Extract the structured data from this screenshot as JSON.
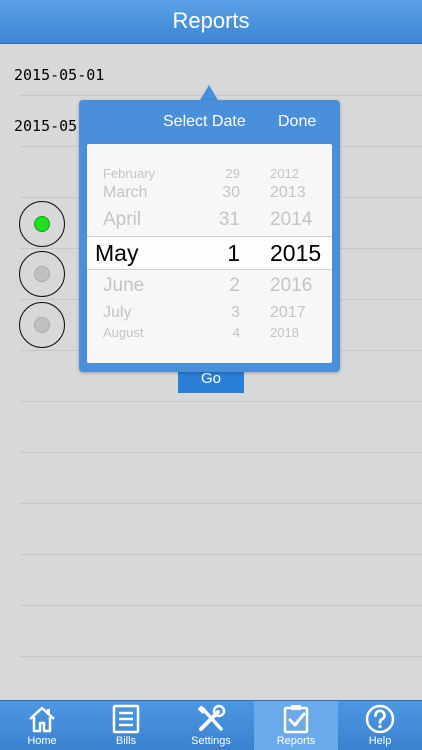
{
  "header": {
    "title": "Reports"
  },
  "dates": {
    "start": "2015-05-01",
    "end_partial": "2015-05"
  },
  "go_button": {
    "label": "Go"
  },
  "radios": [
    {
      "selected": true
    },
    {
      "selected": false
    },
    {
      "selected": false
    }
  ],
  "picker": {
    "title": "Select Date",
    "done": "Done",
    "months": [
      "February",
      "March",
      "April",
      "May",
      "June",
      "July",
      "August"
    ],
    "days": [
      "29",
      "30",
      "31",
      "1",
      "2",
      "3",
      "4"
    ],
    "years": [
      "2012",
      "2013",
      "2014",
      "2015",
      "2016",
      "2017",
      "2018"
    ],
    "selected": {
      "month": "May",
      "day": "1",
      "year": "2015"
    }
  },
  "tabs": [
    {
      "label": "Home",
      "icon": "home-icon"
    },
    {
      "label": "Bills",
      "icon": "bills-icon"
    },
    {
      "label": "Settings",
      "icon": "settings-icon"
    },
    {
      "label": "Reports",
      "icon": "reports-icon",
      "active": true
    },
    {
      "label": "Help",
      "icon": "help-icon"
    }
  ],
  "colors": {
    "accent": "#3e86d4",
    "selected_dot": "#22dd22"
  }
}
